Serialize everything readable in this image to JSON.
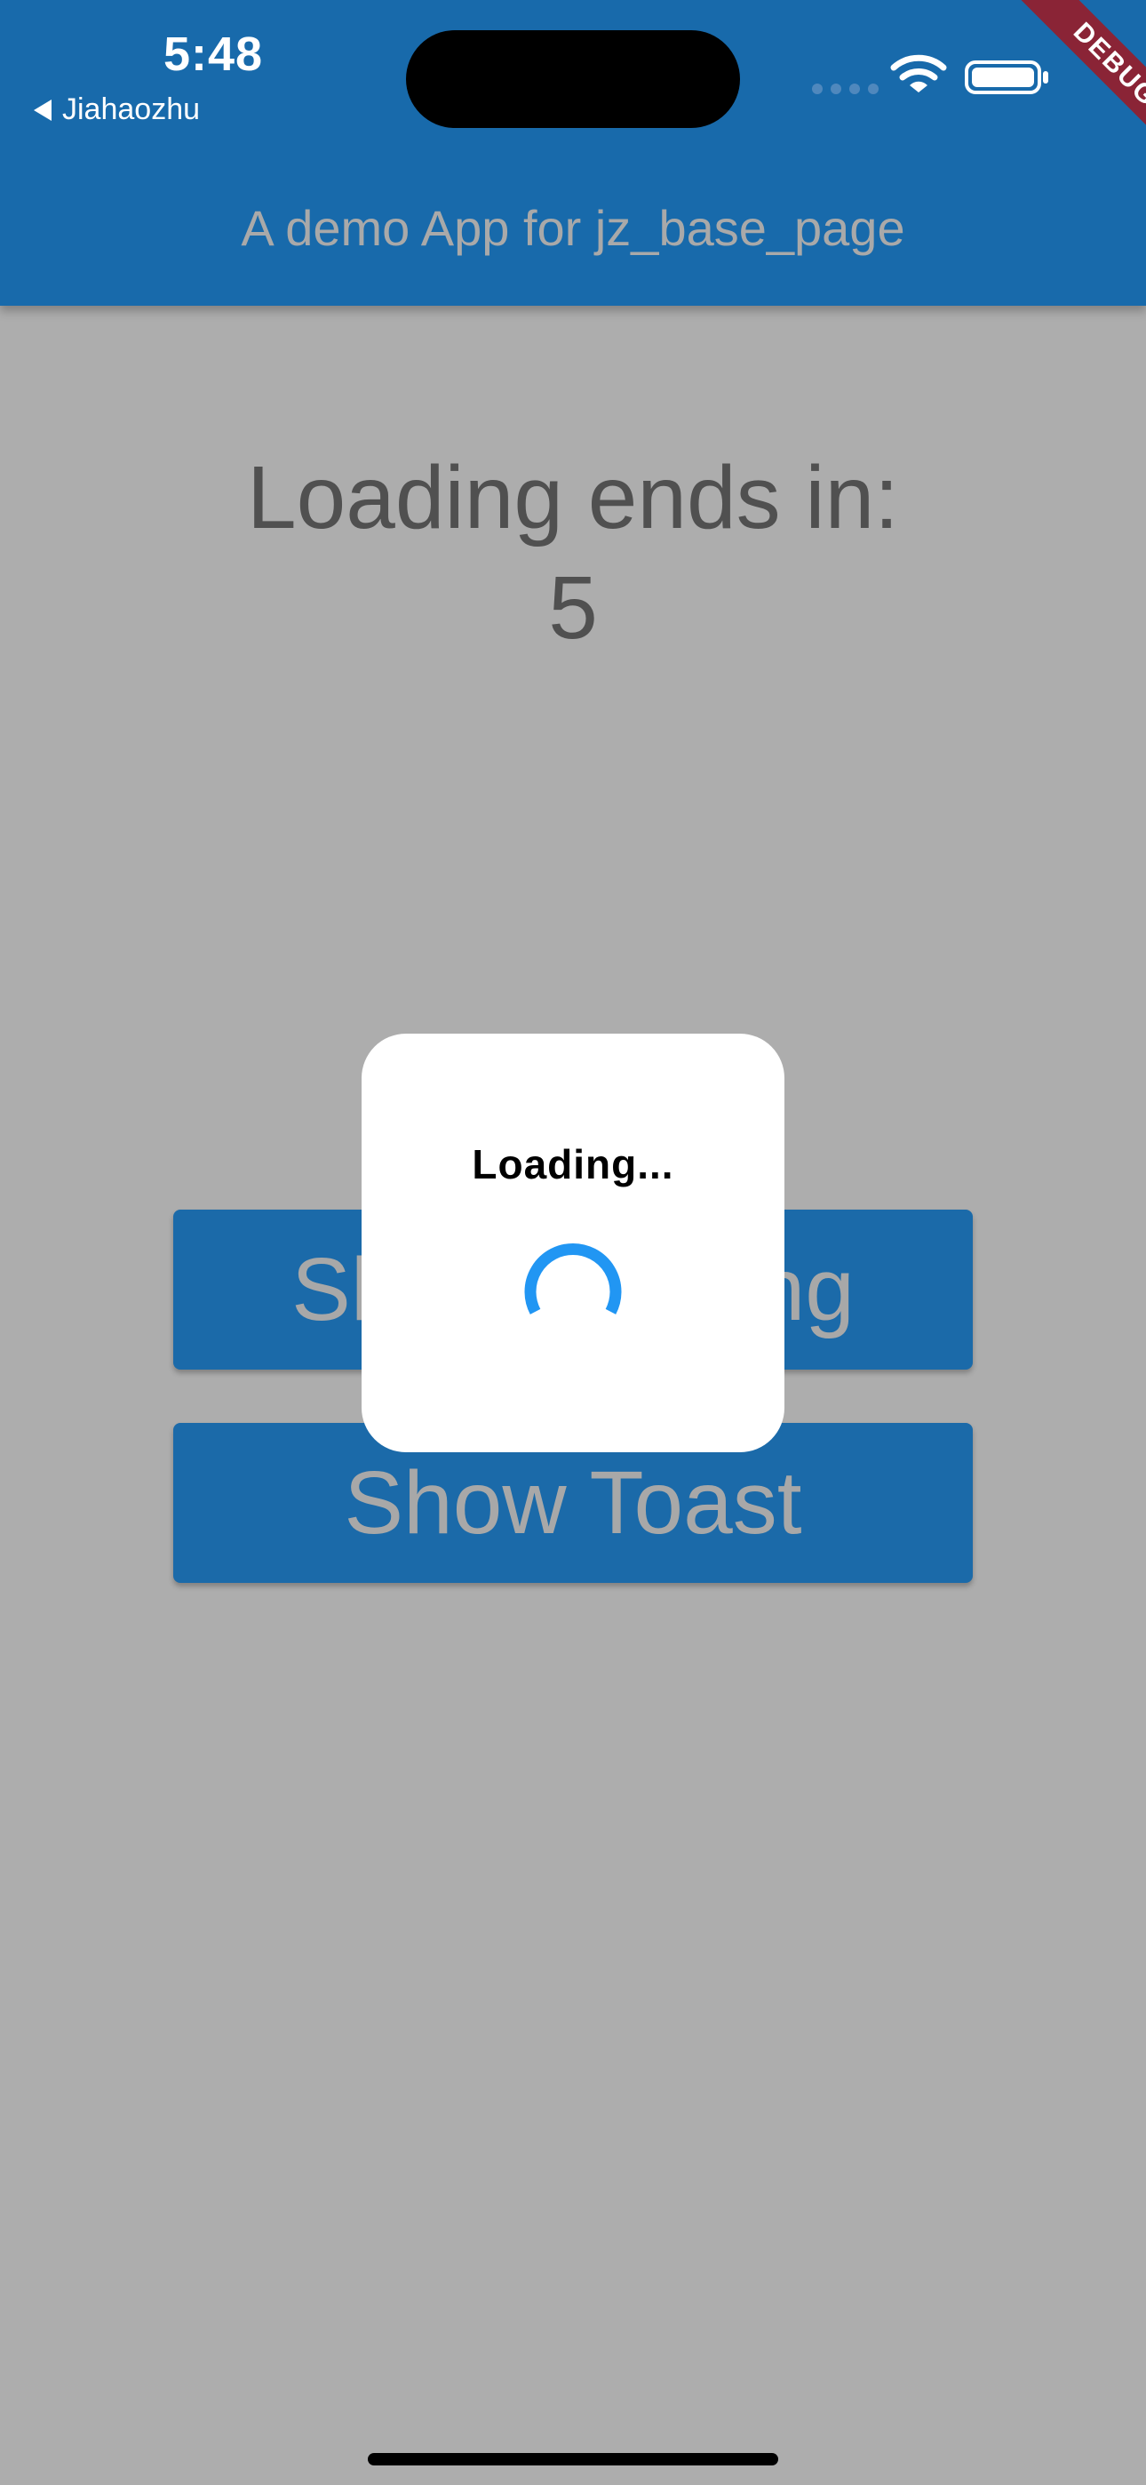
{
  "status_bar": {
    "time": "5:48",
    "back_label": "Jiahaozhu",
    "icons": [
      "signal-icon",
      "wifi-icon",
      "battery-icon"
    ]
  },
  "debug_banner": "DEBUG",
  "app_bar": {
    "title": "A demo App for jz_base_page"
  },
  "main": {
    "countdown_label": "Loading ends in:",
    "countdown_value": "5",
    "buttons": {
      "show_loading": "Show Loading",
      "show_toast": "Show Toast"
    }
  },
  "loading_dialog": {
    "text": "Loading..."
  },
  "colors": {
    "app_bar": "#186aab",
    "background_dimmed": "#adadad",
    "button": "#1b6aa9",
    "spinner": "#2196f3",
    "debug_banner": "#8a2436"
  }
}
